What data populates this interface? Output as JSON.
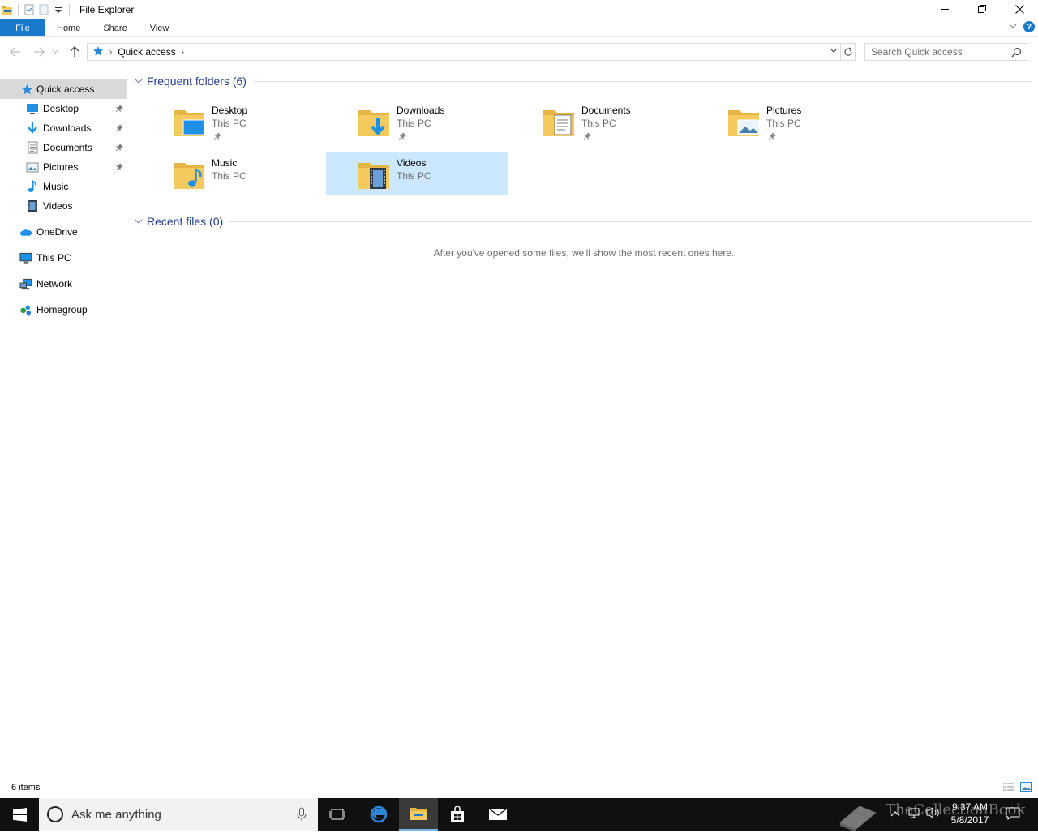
{
  "window": {
    "title": "File Explorer"
  },
  "ribbon": {
    "tabs": [
      "File",
      "Home",
      "Share",
      "View"
    ]
  },
  "address": {
    "crumbs": [
      "Quick access"
    ]
  },
  "search": {
    "placeholder": "Search Quick access"
  },
  "sidebar": {
    "quick_access": "Quick access",
    "items": [
      {
        "label": "Desktop",
        "icon": "desktop-icon",
        "pinned": true
      },
      {
        "label": "Downloads",
        "icon": "downloads-icon",
        "pinned": true
      },
      {
        "label": "Documents",
        "icon": "documents-icon",
        "pinned": true
      },
      {
        "label": "Pictures",
        "icon": "pictures-icon",
        "pinned": true
      },
      {
        "label": "Music",
        "icon": "music-icon",
        "pinned": false
      },
      {
        "label": "Videos",
        "icon": "videos-icon",
        "pinned": false
      }
    ],
    "roots": [
      {
        "label": "OneDrive",
        "icon": "onedrive-icon"
      },
      {
        "label": "This PC",
        "icon": "this-pc-icon"
      },
      {
        "label": "Network",
        "icon": "network-icon"
      },
      {
        "label": "Homegroup",
        "icon": "homegroup-icon"
      }
    ]
  },
  "frequent": {
    "title": "Frequent folders (6)",
    "folders": [
      {
        "name": "Desktop",
        "location": "This PC",
        "pinned": true,
        "selected": false
      },
      {
        "name": "Downloads",
        "location": "This PC",
        "pinned": true,
        "selected": false
      },
      {
        "name": "Documents",
        "location": "This PC",
        "pinned": true,
        "selected": false
      },
      {
        "name": "Pictures",
        "location": "This PC",
        "pinned": true,
        "selected": false
      },
      {
        "name": "Music",
        "location": "This PC",
        "pinned": false,
        "selected": false
      },
      {
        "name": "Videos",
        "location": "This PC",
        "pinned": false,
        "selected": true
      }
    ]
  },
  "recent": {
    "title": "Recent files (0)",
    "empty_message": "After you've opened some files, we'll show the most recent ones here."
  },
  "status": {
    "items": "6 items"
  },
  "taskbar": {
    "search_text": "Ask me anything",
    "time": "9:37 AM",
    "date": "5/8/2017"
  },
  "watermark": {
    "text": "TheCollectionBook"
  },
  "colors": {
    "accent": "#1979ca",
    "selection": "#cce8ff",
    "group_title": "#1e3c8c",
    "folder_yellow": "#f4c95d",
    "taskbar": "#101010"
  }
}
